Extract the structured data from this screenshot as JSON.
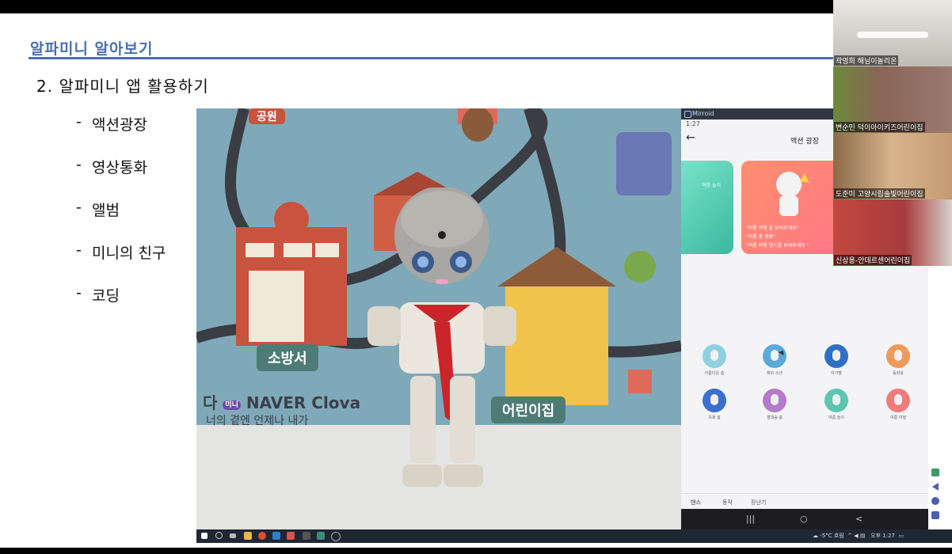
{
  "slide": {
    "title": "알파미니 알아보기",
    "section_heading": "2. 알파미니 앱 활용하기",
    "bullets": [
      "액션광장",
      "영상통화",
      "앨범",
      "미니의 친구",
      "코딩"
    ]
  },
  "video_scene": {
    "sign_fire": "소방서",
    "sign_kids": "어린이집",
    "brand": "NAVER Clova",
    "brand_badge": "미니",
    "brand_prefix": "다",
    "brand_sub": "너의 곁엔 언제나 내가",
    "sign_top": "공원"
  },
  "mirror": {
    "app_name": "Mirroid",
    "time": "1:27",
    "screen_title": "액션 광장",
    "card_left_label": "여름 놀이",
    "card_quotes": [
      "\"여름 여행 을 보여주세요\"",
      "\"여름 춤 춰봐\"",
      "\"여름 여행 댄스를 보여주세요 \""
    ],
    "icons": [
      {
        "label": "아름다운 춤",
        "color": "#8ed0df"
      },
      {
        "label": "해피 소년",
        "color": "#5aa9d9"
      },
      {
        "label": "아기별",
        "color": "#2f6fc4"
      },
      {
        "label": "동화왕",
        "color": "#f09a5a"
      },
      {
        "label": "유쾌 봄",
        "color": "#3a6fd0"
      },
      {
        "label": "열대숲 춤",
        "color": "#b37bc9"
      },
      {
        "label": "여름 놀이",
        "color": "#5cc6b0"
      },
      {
        "label": "여름 여행",
        "color": "#f27a7a"
      }
    ],
    "tabs": [
      "댄스",
      "동작",
      "장난기"
    ],
    "nav": [
      "|||",
      "○",
      "<"
    ]
  },
  "taskbar": {
    "weather": "-5°C 흐림",
    "time": "오후 1:27"
  },
  "participants": [
    {
      "name": "곽영희 해님이놀리온",
      "bg": "#bfbcb3"
    },
    {
      "name": "변순민 덕이아이키즈어린이집",
      "bg": "#8a6558"
    },
    {
      "name": "도준미 고양시립솔빛어린이집",
      "bg": "#c49a73"
    },
    {
      "name": "신상용-안데르센어린이집",
      "bg": "#a83b3e"
    }
  ]
}
